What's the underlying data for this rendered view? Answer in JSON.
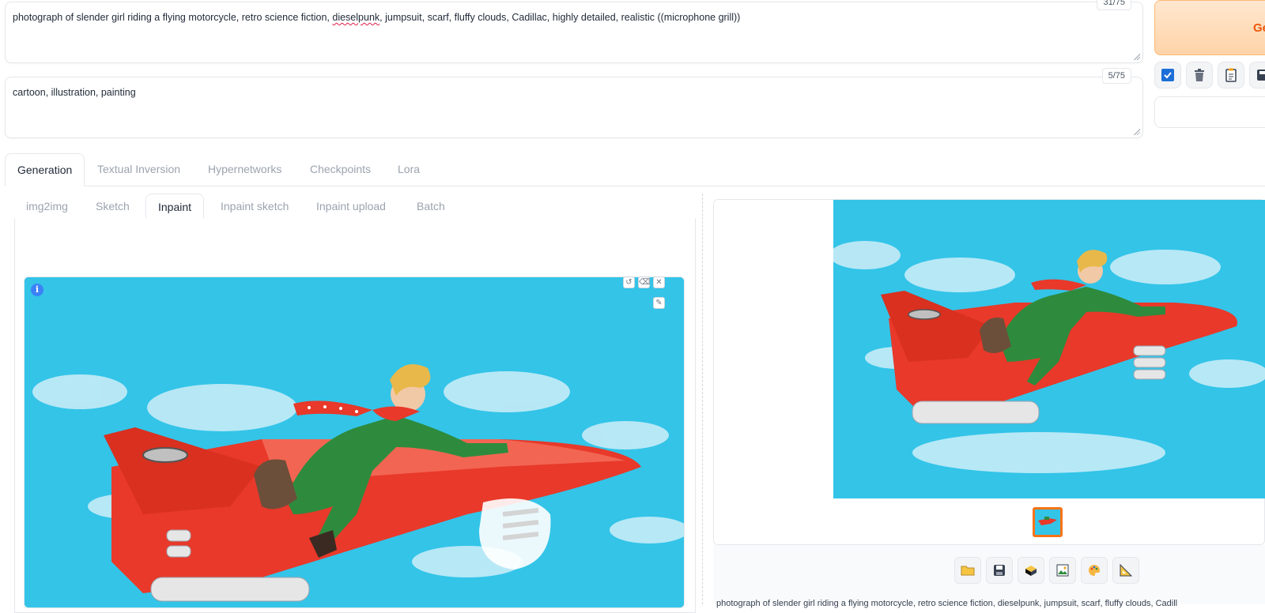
{
  "prompt": {
    "positive_before": "photograph of slender girl riding a flying motorcycle, retro science fiction, ",
    "positive_spell": "dieselpunk",
    "positive_after": ", jumpsuit, scarf, fluffy clouds, Cadillac, highly detailed, realistic ((microphone grill))",
    "positive_counter": "31/75",
    "negative": "cartoon, illustration, painting",
    "negative_counter": "5/75"
  },
  "generate_label": "Ge",
  "tools": [
    "checkbox-icon",
    "trash-icon",
    "clipboard-icon",
    "save-style-icon"
  ],
  "main_tabs": [
    "Generation",
    "Textual Inversion",
    "Hypernetworks",
    "Checkpoints",
    "Lora"
  ],
  "sub_tabs": [
    "img2img",
    "Sketch",
    "Inpaint",
    "Inpaint sketch",
    "Inpaint upload",
    "Batch"
  ],
  "canvas": {
    "info": "i",
    "undo": "↺",
    "erase": "⌫",
    "close": "✕",
    "brush": "✎"
  },
  "output_buttons": [
    "folder-icon",
    "save-icon",
    "zip-icon",
    "image-icon",
    "palette-icon",
    "ruler-icon"
  ],
  "output_caption": "photograph of slender girl riding a flying motorcycle, retro science fiction, dieselpunk, jumpsuit, scarf, fluffy clouds, Cadill",
  "colors": {
    "accent": "#ea580c",
    "sky": "#33c4e8",
    "rocket": "#e8392a",
    "suit": "#2e8b3d"
  }
}
